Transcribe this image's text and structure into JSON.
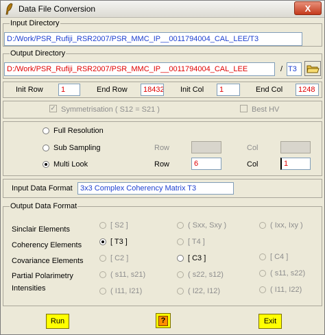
{
  "window": {
    "title": "Data File Conversion",
    "close_glyph": "X"
  },
  "input_directory": {
    "label": "Input Directory",
    "value": "D:/Work/PSR_Rufiji_RSR2007/PSR_MMC_IP__0011794004_CAL_LEE/T3"
  },
  "output_directory": {
    "label": "Output Directory",
    "value": "D:/Work/PSR_Rufiji_RSR2007/PSR_MMC_IP__0011794004_CAL_LEE",
    "separator": "/",
    "subdir": "T3"
  },
  "rows_cols": {
    "init_row_label": "Init Row",
    "init_row": "1",
    "end_row_label": "End Row",
    "end_row": "18432",
    "init_col_label": "Init Col",
    "init_col": "1",
    "end_col_label": "End Col",
    "end_col": "1248"
  },
  "options": {
    "symmetrisation_label": "Symmetrisation ( S12 = S21 )",
    "symmetrisation_checked": true,
    "best_hv_label": "Best HV",
    "best_hv_checked": false
  },
  "resolution": {
    "full_resolution": "Full Resolution",
    "sub_sampling": "Sub Sampling",
    "multi_look": "Multi Look",
    "selected": "multi_look",
    "sub_row_label": "Row",
    "sub_col_label": "Col",
    "ml_row_label": "Row",
    "ml_row": "6",
    "ml_col_label": "Col",
    "ml_col": "1"
  },
  "input_format": {
    "label": "Input Data Format",
    "value": "3x3 Complex Coherency Matrix T3"
  },
  "output_format": {
    "label": "Output Data Format",
    "rows": [
      {
        "label": "Sinclair Elements",
        "opts": [
          "[ S2 ]",
          "( Sxx, Sxy )",
          "( Ixx, Ixy )"
        ]
      },
      {
        "label": "Coherency Elements",
        "opts": [
          "[ T3 ]",
          "[ T4 ]"
        ]
      },
      {
        "label": "Covariance Elements",
        "opts": [
          "[ C2 ]",
          "[ C3 ]",
          "[ C4 ]"
        ]
      },
      {
        "label": "Partial Polarimetry",
        "opts": [
          "( s11, s21)",
          "( s22, s12)",
          "( s11, s22)"
        ]
      },
      {
        "label": "Intensities",
        "opts": [
          "( I11, I21)",
          "( I22, I12)",
          "( I11, I22)"
        ]
      }
    ],
    "selected": "[ T3 ]"
  },
  "buttons": {
    "run": "Run",
    "help": "?",
    "exit": "Exit"
  },
  "colors": {
    "accent_value": "#e00000",
    "format_value": "#1c3fd0",
    "button": "#ffff00",
    "help_button": "#ff8c00"
  },
  "icons": {
    "app": "feather-pen-icon",
    "folder": "folder-icon"
  }
}
